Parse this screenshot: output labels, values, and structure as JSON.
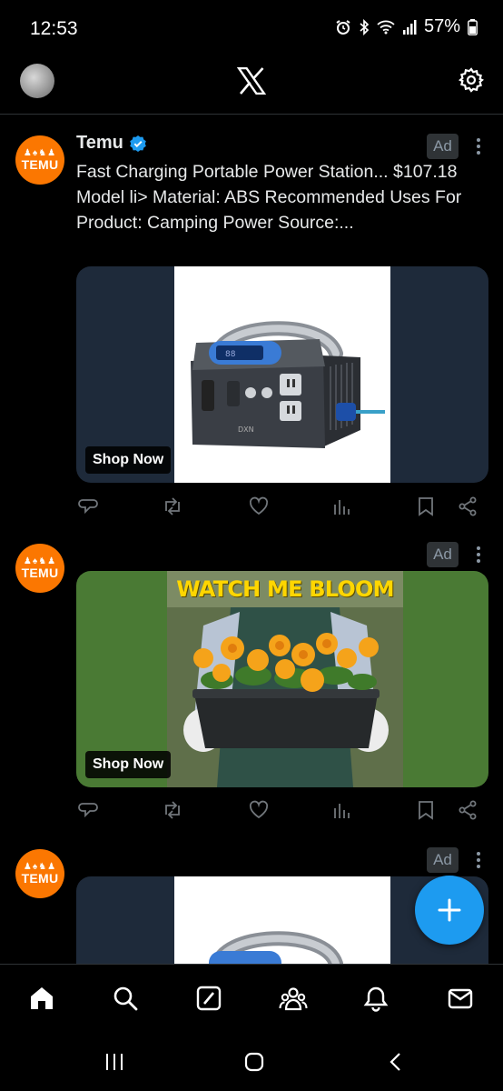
{
  "status_bar": {
    "time": "12:53",
    "battery": "57%",
    "icons": [
      "alarm-icon",
      "bluetooth-icon",
      "wifi-icon",
      "signal-icon",
      "battery-icon"
    ]
  },
  "header": {
    "logo": "x-logo-icon",
    "settings": "gear-icon"
  },
  "posts": [
    {
      "author": "Temu",
      "verified": true,
      "badge": "Ad",
      "avatar_brand": "TEMU",
      "text": "Fast Charging Portable Power Station... $107.18 Model li> Material: ABS Recommended Uses For Product: Camping Power Source:...",
      "cta": "Shop Now",
      "media_subject": "power-station-image"
    },
    {
      "author": "Temu",
      "badge": "Ad",
      "avatar_brand": "TEMU",
      "cta": "Shop Now",
      "image_title": "WATCH ME BLOOM",
      "media_subject": "flower-planter-image"
    },
    {
      "author": "Temu",
      "badge": "Ad",
      "avatar_brand": "TEMU",
      "media_subject": "power-station-image"
    }
  ],
  "actions": [
    "reply-icon",
    "retweet-icon",
    "like-icon",
    "views-icon",
    "bookmark-icon",
    "share-icon"
  ],
  "bottom_nav": [
    "home-icon",
    "search-icon",
    "grok-icon",
    "communities-icon",
    "notifications-icon",
    "messages-icon"
  ],
  "colors": {
    "accent": "#1d9bf0",
    "temu": "#fb7701",
    "background": "#000000"
  }
}
